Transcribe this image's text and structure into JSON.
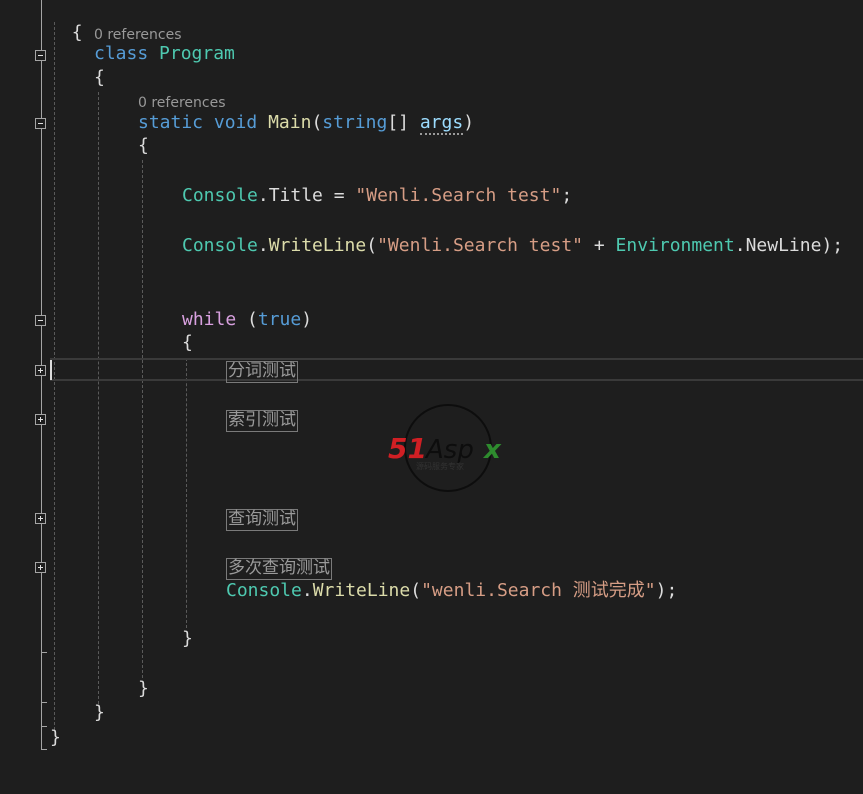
{
  "code": {
    "open_brace_namespace": "{",
    "class_lens": "0 references",
    "class_kw": "class",
    "class_name": "Program",
    "open_brace_class": "{",
    "main_lens": "0 references",
    "static_kw": "static",
    "void_kw": "void",
    "main_name": "Main",
    "paren_open": "(",
    "string_kw": "string",
    "brackets": "[]",
    "args_name": "args",
    "paren_close": ")",
    "open_brace_main": "{",
    "console_1": "Console",
    "dot": ".",
    "title_prop": "Title",
    "assign": " = ",
    "title_str": "\"Wenli.Search test\"",
    "semi": ";",
    "console_2": "Console",
    "writeline_1": "WriteLine",
    "wl_str": "\"Wenli.Search test\"",
    "plus": " + ",
    "environment": "Environment",
    "newline_prop": "NewLine",
    "close_call": ");",
    "while_kw": "while",
    "while_open": " (",
    "true_kw": "true",
    "while_close": ")",
    "open_brace_while": "{",
    "region_1": "分词测试",
    "region_2": "索引测试",
    "region_3": "查询测试",
    "region_4": "多次查询测试",
    "console_3": "Console",
    "writeline_2": "WriteLine",
    "done_open": "(",
    "done_str": "\"wenli.Search 测试完成\"",
    "done_close": ");",
    "close_brace_while": "}",
    "close_brace_main": "}",
    "close_brace_class": "}",
    "close_brace_namespace": "}"
  },
  "watermark": {
    "brand": "51Aspx",
    "tagline": "源码服务专家"
  },
  "colors": {
    "background": "#1e1e1e",
    "keyword": "#569cd6",
    "control_keyword": "#d8a0df",
    "type": "#4ec9b0",
    "method": "#dcdcaa",
    "string": "#d69d85",
    "parameter": "#9cdcfe",
    "text": "#dcdcdc"
  }
}
